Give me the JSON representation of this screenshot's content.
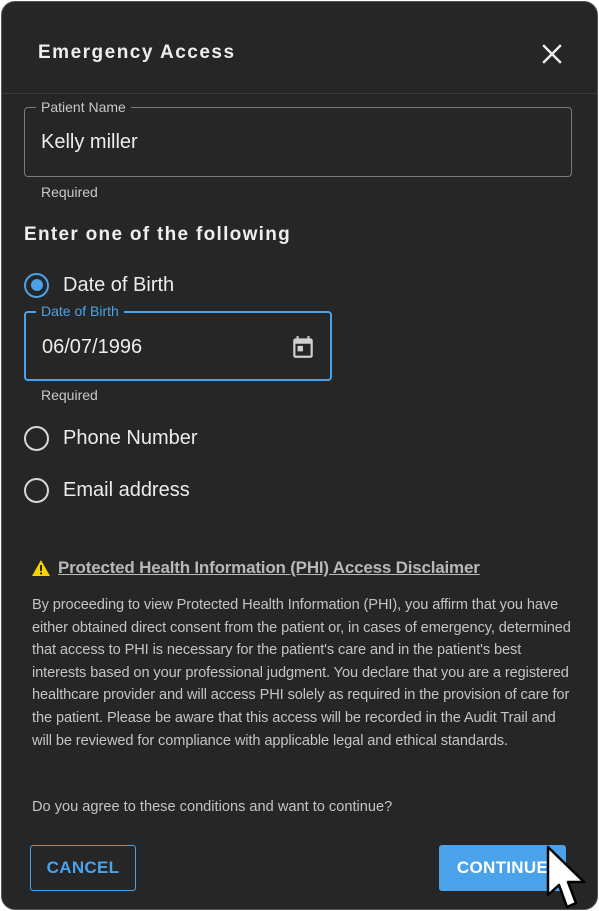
{
  "dialog": {
    "title": "Emergency Access",
    "close_icon": "close-icon"
  },
  "patient_name": {
    "label": "Patient Name",
    "value": "Kelly miller",
    "helper": "Required"
  },
  "identifier_section": {
    "heading": "Enter one of the following",
    "options": [
      {
        "label": "Date of Birth",
        "selected": true
      },
      {
        "label": "Phone Number",
        "selected": false
      },
      {
        "label": "Email address",
        "selected": false
      }
    ],
    "dob_field": {
      "label": "Date of Birth",
      "value": "06/07/1996",
      "helper": "Required",
      "icon": "calendar-icon"
    }
  },
  "disclaimer": {
    "icon": "warning-icon",
    "title": "Protected Health Information (PHI) Access Disclaimer",
    "body": "By proceeding to view Protected Health Information (PHI), you affirm that you have either obtained direct consent from the patient or, in cases of emergency, determined that access to PHI is necessary for the patient's care and in the patient's best interests based on your professional judgment. You declare that you are a registered healthcare provider and will access PHI solely as required in the provision of care for the patient. Please be aware that this access will be recorded in the Audit Trail and will be reviewed for compliance with applicable legal and ethical standards.",
    "question": "Do you agree to these conditions and want to continue?"
  },
  "actions": {
    "cancel_label": "CANCEL",
    "continue_label": "CONTINUE"
  },
  "colors": {
    "background": "#262626",
    "accent": "#4aa3ea",
    "warning": "#f5d400"
  }
}
